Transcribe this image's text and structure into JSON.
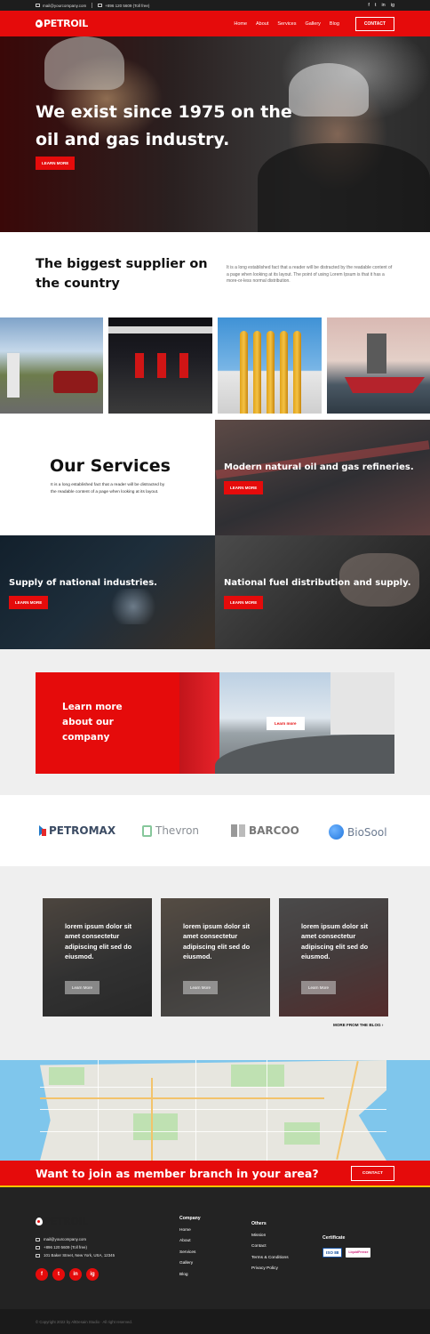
{
  "topbar": {
    "email": "mail@yourcompany.com",
    "phone": "+896 120 5609 (Toll free)",
    "socials": [
      "f",
      "t",
      "in",
      "ig"
    ]
  },
  "brand": {
    "name": "PETROIL",
    "accent": "#e50b0b"
  },
  "nav": {
    "links": [
      "Home",
      "About",
      "Services",
      "Gallery",
      "Blog"
    ],
    "contact_label": "CONTACT"
  },
  "hero": {
    "title": "We exist since 1975 on the oil and gas industry.",
    "button": "LEARN MORE"
  },
  "supplier": {
    "title": "The biggest supplier on the country",
    "text": "It is a long established fact that a reader will be distracted by the readable content of a page when looking at its layout. The point of using Lorem Ipsum is that it has a more-or-less normal distribution."
  },
  "services": {
    "title": "Our Services",
    "text": "It is a long established fact that a reader will be distracted by the readable content of a page when looking at its layout.",
    "tiles": [
      {
        "title": "Modern natural oil and gas refineries.",
        "button": "LEARN MORE"
      },
      {
        "title": "Supply of national industries.",
        "button": "LEARN MORE"
      },
      {
        "title": "National fuel distribution and supply.",
        "button": "LEARN MORE"
      }
    ]
  },
  "learn_banner": {
    "title": "Learn more about our company",
    "button": "Learn more"
  },
  "brands": [
    "PETROMAX",
    "Thevron",
    "BARCOO",
    "BioSool"
  ],
  "blog": {
    "cards": [
      {
        "text": "lorem ipsum dolor sit amet consectetur adipiscing elit sed do eiusmod.",
        "button": "Learn More"
      },
      {
        "text": "lorem ipsum dolor sit amet consectetur adipiscing elit sed do eiusmod.",
        "button": "Learn More"
      },
      {
        "text": "lorem ipsum dolor sit amet consectetur adipiscing elit sed do eiusmod.",
        "button": "Learn More"
      }
    ],
    "more_link": "MORE FROM THE BLOG ›"
  },
  "join": {
    "title": "Want to join as member branch in your area?",
    "button": "CONTACT"
  },
  "footer": {
    "email": "mail@yourcompany.com",
    "phone": "+896 120 5609 (Toll free)",
    "address": "101 Baker Street, New York, USA, 12345",
    "socials": [
      "f",
      "t",
      "in",
      "ig"
    ],
    "company": {
      "heading": "Company",
      "links": [
        "Home",
        "About",
        "Services",
        "Gallery",
        "Blog"
      ]
    },
    "others": {
      "heading": "Others",
      "links": [
        "Mission",
        "Contact",
        "Terms & Conditions",
        "Privacy Policy"
      ]
    },
    "certificate": {
      "heading": "Certificate",
      "badges": [
        "ISO 88",
        "LiquidFreeze"
      ]
    },
    "copyright": "© Copyright 2022 by AltDesain Studio · All right reserved."
  }
}
